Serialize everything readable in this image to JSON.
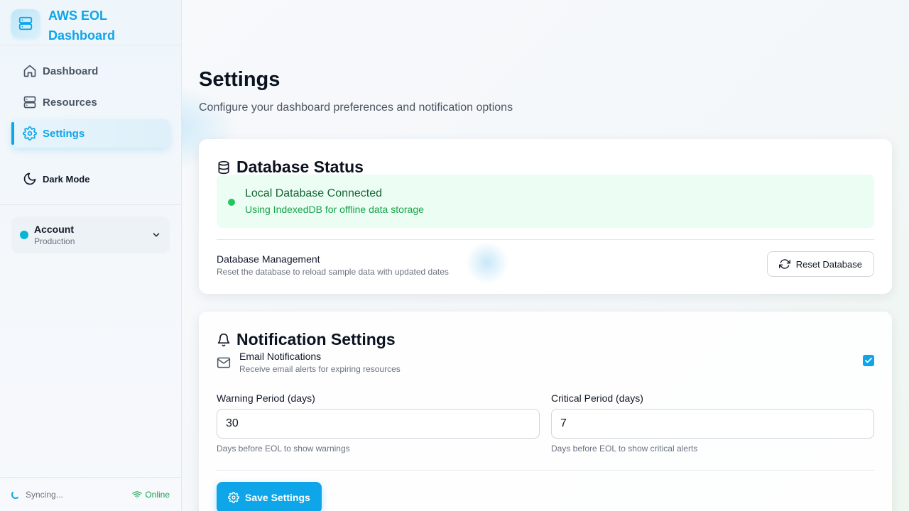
{
  "brand": {
    "title": "AWS EOL Dashboard"
  },
  "nav": {
    "items": [
      {
        "label": "Dashboard",
        "icon": "home-icon"
      },
      {
        "label": "Resources",
        "icon": "server-icon"
      },
      {
        "label": "Settings",
        "icon": "gear-icon",
        "active": true
      }
    ]
  },
  "dark_mode": {
    "label": "Dark Mode"
  },
  "account": {
    "name": "Account",
    "environment": "Production"
  },
  "footer": {
    "sync_label": "Syncing...",
    "online_label": "Online"
  },
  "page": {
    "title": "Settings",
    "subtitle": "Configure your dashboard preferences and notification options"
  },
  "database": {
    "title": "Database Status",
    "status_title": "Local Database Connected",
    "status_desc": "Using IndexedDB for offline data storage",
    "mgmt_title": "Database Management",
    "mgmt_desc": "Reset the database to reload sample data with updated dates",
    "reset_label": "Reset Database"
  },
  "notifications": {
    "title": "Notification Settings",
    "email_title": "Email Notifications",
    "email_desc": "Receive email alerts for expiring resources",
    "email_enabled": true,
    "warning_label": "Warning Period (days)",
    "warning_value": "30",
    "warning_help": "Days before EOL to show warnings",
    "critical_label": "Critical Period (days)",
    "critical_value": "7",
    "critical_help": "Days before EOL to show critical alerts",
    "save_label": "Save Settings"
  },
  "colors": {
    "accent": "#0ea5e9",
    "success": "#22c55e",
    "online": "#16a34a"
  }
}
